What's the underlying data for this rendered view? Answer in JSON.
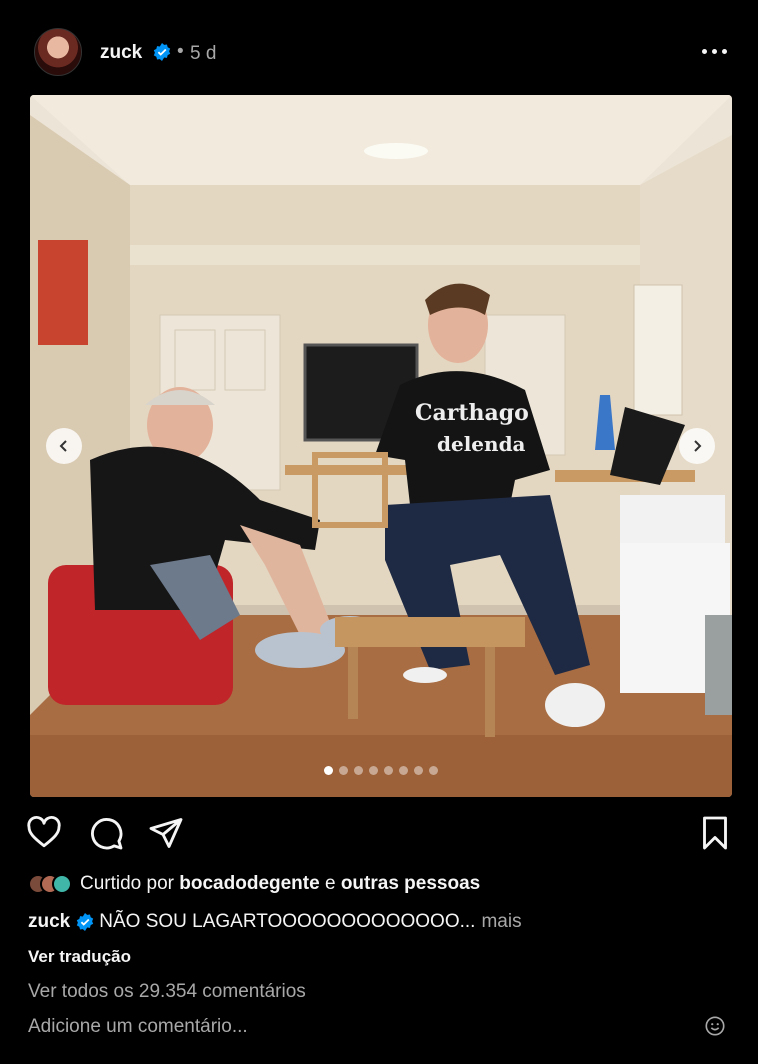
{
  "post": {
    "username": "zuck",
    "separator": "•",
    "time": "5 d",
    "verified_icon": "verified-badge-icon",
    "more_icon": "more-options-icon"
  },
  "media": {
    "photo_shirt_text_1": "Carthago",
    "photo_shirt_text_2": "delenda",
    "carousel_count": 8,
    "carousel_active_index": 0
  },
  "actions": {
    "like_icon": "heart-icon",
    "comment_icon": "comment-icon",
    "share_icon": "send-icon",
    "save_icon": "bookmark-icon"
  },
  "likes": {
    "prefix": "Curtido por",
    "user": "bocadodegente",
    "conjunction": "e",
    "others": "outras pessoas"
  },
  "caption": {
    "username": "zuck",
    "text": "NÃO SOU LAGARTOOOOOOOOOOOOO...",
    "more": "mais"
  },
  "translate_label": "Ver tradução",
  "view_comments_label": "Ver todos os 29.354 comentários",
  "add_comment_placeholder": "Adicione um comentário...",
  "colors": {
    "background": "#000000",
    "text": "#f5f5f5",
    "secondary_text": "#a8a8a8",
    "verified_blue": "#0095f6"
  }
}
